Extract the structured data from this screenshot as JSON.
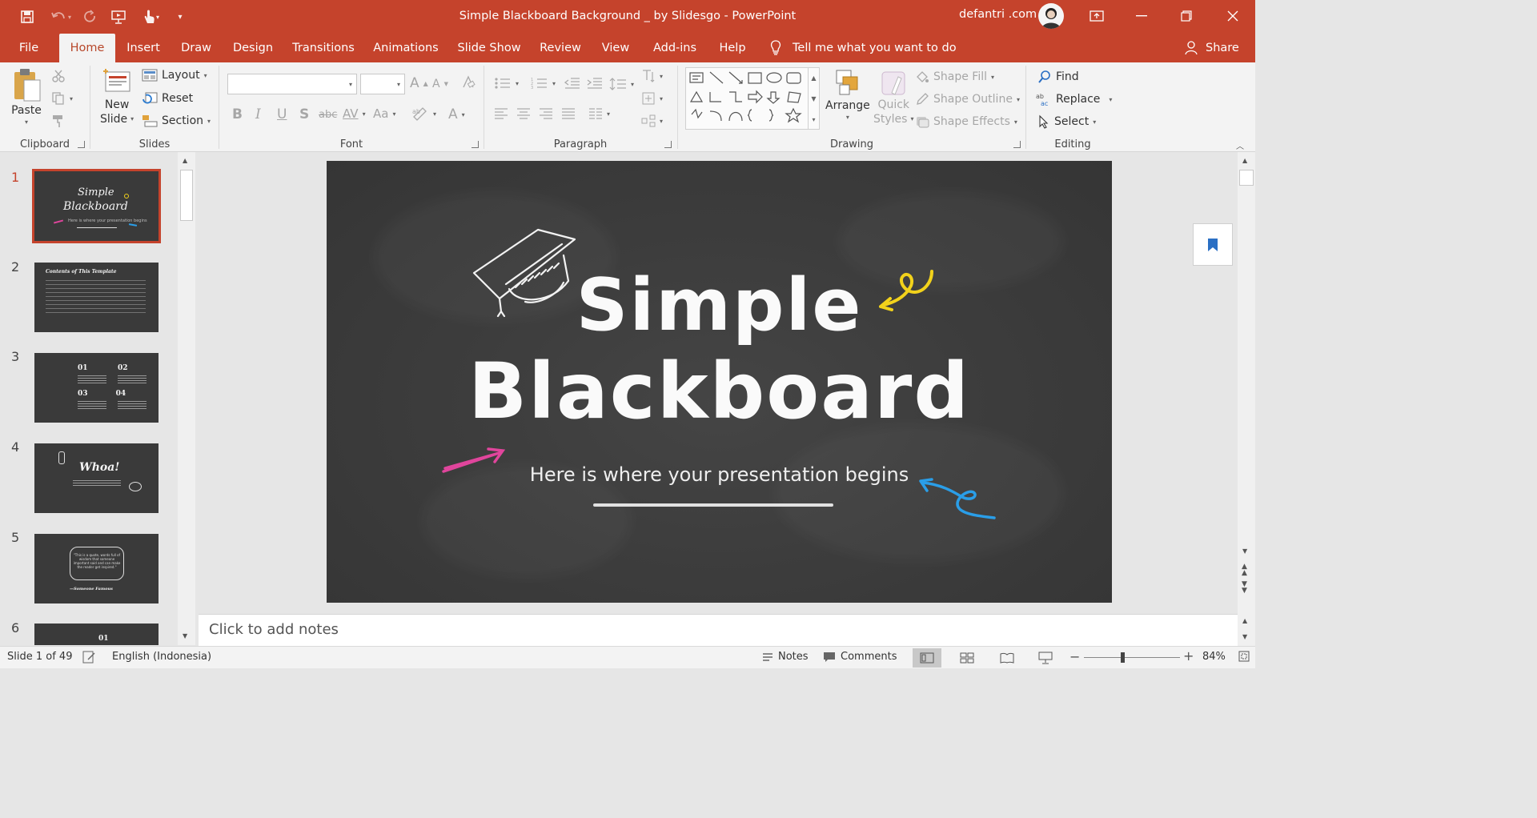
{
  "window": {
    "title": "Simple Blackboard Background _ by Slidesgo  -  PowerPoint",
    "user": "defantri .com"
  },
  "tabs": [
    "File",
    "Home",
    "Insert",
    "Draw",
    "Design",
    "Transitions",
    "Animations",
    "Slide Show",
    "Review",
    "View",
    "Add-ins",
    "Help"
  ],
  "tell_me": "Tell me what you want to do",
  "share": "Share",
  "ribbon": {
    "clipboard": {
      "label": "Clipboard",
      "paste": "Paste"
    },
    "slides": {
      "label": "Slides",
      "new_slide_1": "New",
      "new_slide_2": "Slide",
      "layout": "Layout",
      "reset": "Reset",
      "section": "Section"
    },
    "font": {
      "label": "Font",
      "bold": "B",
      "italic": "I",
      "underline": "U",
      "shadow": "S",
      "strike": "abc",
      "spacing": "AV",
      "case": "Aa",
      "grow": "A",
      "shrink": "A",
      "color": "A"
    },
    "paragraph": {
      "label": "Paragraph"
    },
    "drawing": {
      "label": "Drawing",
      "arrange": "Arrange",
      "quick_1": "Quick",
      "quick_2": "Styles",
      "shape_fill": "Shape Fill",
      "shape_outline": "Shape Outline",
      "shape_effects": "Shape Effects"
    },
    "editing": {
      "label": "Editing",
      "find": "Find",
      "replace": "Replace",
      "select": "Select"
    }
  },
  "thumbnails": [
    {
      "num": "1",
      "title_a": "Simple",
      "title_b": "Blackboard",
      "sub": "Here is where your presentation begins"
    },
    {
      "num": "2",
      "title_a": "Contents of This Template",
      "title_b": "",
      "sub": ""
    },
    {
      "num": "3",
      "title_a": "01",
      "title_b": "02",
      "sub": "03  04"
    },
    {
      "num": "4",
      "title_a": "Whoa!",
      "title_b": "",
      "sub": ""
    },
    {
      "num": "5",
      "title_a": "\"This is a quote, words full of wisdom that someone important said and can make the reader get inspired.\"",
      "title_b": "—Someone Famous",
      "sub": ""
    },
    {
      "num": "6",
      "title_a": "01",
      "title_b": "",
      "sub": ""
    }
  ],
  "slide": {
    "title_line1": "Simple",
    "title_line2": "Blackboard",
    "subtitle": "Here is where your presentation begins",
    "accent_yellow": "#f2d21b",
    "accent_pink": "#e0459c",
    "accent_blue": "#2a9ee8"
  },
  "notes_placeholder": "Click to add notes",
  "status": {
    "slide_info": "Slide 1 of 49",
    "language": "English (Indonesia)",
    "notes": "Notes",
    "comments": "Comments",
    "zoom": "84%"
  },
  "colors": {
    "accent": "#c5432c",
    "ribbon_bg": "#f3f3f3"
  }
}
